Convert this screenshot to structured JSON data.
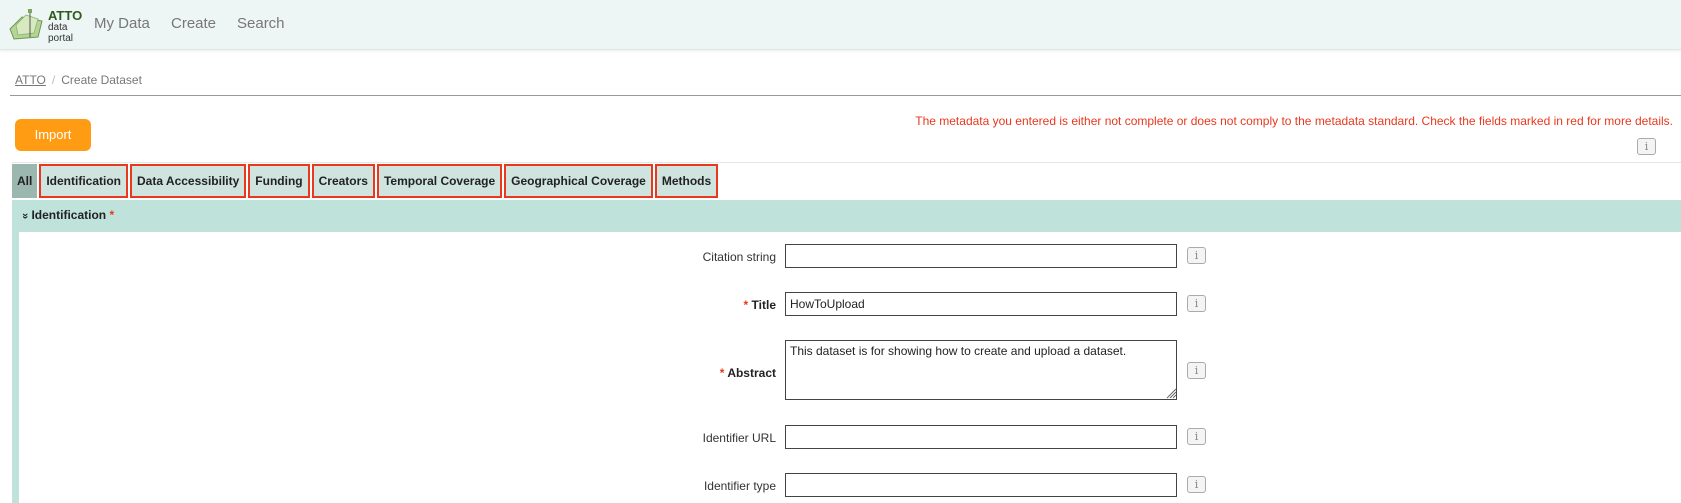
{
  "navbar": {
    "logo": {
      "title": "ATTO",
      "line2": "data",
      "line3": "portal"
    },
    "items": [
      {
        "label": "My Data"
      },
      {
        "label": "Create"
      },
      {
        "label": "Search"
      }
    ]
  },
  "breadcrumb": {
    "root": "ATTO",
    "separator": "/",
    "current": "Create Dataset"
  },
  "toolbar": {
    "import_label": "Import"
  },
  "validation": {
    "message": "The metadata you entered is either not complete or does not comply to the metadata standard. Check the fields marked in red for more details."
  },
  "info_glyph": "i",
  "tabs": [
    {
      "label": "All"
    },
    {
      "label": "Identification"
    },
    {
      "label": "Data Accessibility"
    },
    {
      "label": "Funding"
    },
    {
      "label": "Creators"
    },
    {
      "label": "Temporal Coverage"
    },
    {
      "label": "Geographical Coverage"
    },
    {
      "label": "Methods"
    }
  ],
  "section": {
    "chevron": "»",
    "title": "Identification",
    "required_mark": "*"
  },
  "fields": {
    "citation_string": {
      "label": "Citation string",
      "value": ""
    },
    "title": {
      "required_mark": "*",
      "label": "Title",
      "value": "HowToUpload"
    },
    "abstract": {
      "required_mark": "*",
      "label": "Abstract",
      "value": "This dataset is for showing how to create and upload a dataset."
    },
    "identifier_url": {
      "label": "Identifier URL",
      "value": ""
    },
    "identifier_type": {
      "label": "Identifier type",
      "value": ""
    }
  },
  "colors": {
    "navbar_bg": "#eef5f5",
    "accent_orange": "#ff9c14",
    "error_red": "#e8381e",
    "tab_bg": "#cfe4de",
    "section_bg": "#bfe2da"
  }
}
